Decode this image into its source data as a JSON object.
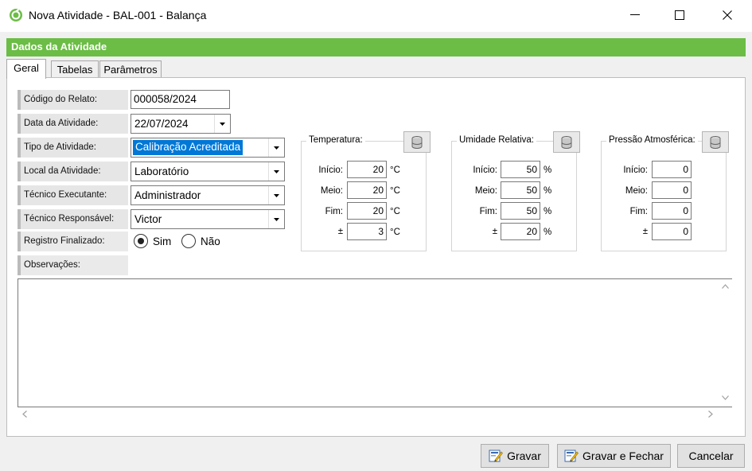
{
  "window": {
    "title": "Nova Atividade - BAL-001 - Balança"
  },
  "header": {
    "title": "Dados da Atividade",
    "color": "#6bbd45"
  },
  "tabs": [
    {
      "label": "Geral",
      "active": true
    },
    {
      "label": "Tabelas",
      "active": false
    },
    {
      "label": "Parâmetros",
      "active": false
    }
  ],
  "fields": {
    "codigo": {
      "label": "Código do Relato:",
      "value": "000058/2024"
    },
    "data": {
      "label": "Data da Atividade:",
      "value": "22/07/2024"
    },
    "tipo": {
      "label": "Tipo de Atividade:",
      "value": "Calibração Acreditada"
    },
    "local": {
      "label": "Local da Atividade:",
      "value": "Laboratório"
    },
    "executante": {
      "label": "Técnico Executante:",
      "value": "Administrador"
    },
    "responsavel": {
      "label": "Técnico Responsável:",
      "value": "Victor"
    },
    "finalizado": {
      "label": "Registro Finalizado:",
      "options": [
        "Sim",
        "Não"
      ],
      "selected": "Sim"
    },
    "observacoes": {
      "label": "Observações:",
      "value": ""
    }
  },
  "groups": {
    "temperatura": {
      "title": "Temperatura:",
      "rows": [
        {
          "label": "Início:",
          "value": "20",
          "unit": "°C"
        },
        {
          "label": "Meio:",
          "value": "20",
          "unit": "°C"
        },
        {
          "label": "Fim:",
          "value": "20",
          "unit": "°C"
        },
        {
          "label": "±",
          "value": "3",
          "unit": "°C"
        }
      ]
    },
    "umidade": {
      "title": "Umidade Relativa:",
      "rows": [
        {
          "label": "Início:",
          "value": "50",
          "unit": "%"
        },
        {
          "label": "Meio:",
          "value": "50",
          "unit": "%"
        },
        {
          "label": "Fim:",
          "value": "50",
          "unit": "%"
        },
        {
          "label": "±",
          "value": "20",
          "unit": "%"
        }
      ]
    },
    "pressao": {
      "title": "Pressão Atmosférica:",
      "rows": [
        {
          "label": "Início:",
          "value": "0",
          "unit": ""
        },
        {
          "label": "Meio:",
          "value": "0",
          "unit": ""
        },
        {
          "label": "Fim:",
          "value": "0",
          "unit": ""
        },
        {
          "label": "±",
          "value": "0",
          "unit": ""
        }
      ]
    }
  },
  "buttons": {
    "gravar": "Gravar",
    "gravar_fechar": "Gravar e Fechar",
    "cancelar": "Cancelar"
  },
  "icons": {
    "app": "refresh-check-icon",
    "group_button": "cylinder-icon",
    "save": "save-edit-icon"
  }
}
